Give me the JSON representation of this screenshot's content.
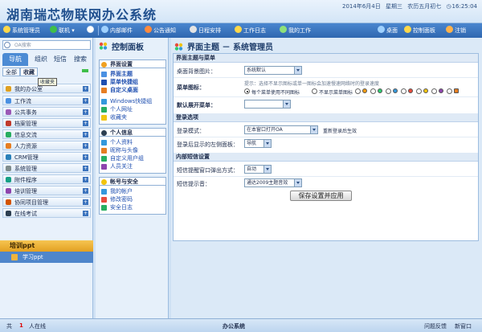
{
  "header": {
    "title": "湖南瑞芯物联网办公系统",
    "date": "2014年6月4日",
    "weekday": "星期三",
    "lunar": "农历五月初七",
    "time": "16:25:04"
  },
  "toolbar": {
    "user": "系统管理员",
    "status": "联机",
    "items": [
      "内部邮件",
      "公告通知",
      "日程安排",
      "工作日志",
      "我的工作"
    ],
    "right": [
      "桌面",
      "控制面板",
      "注销"
    ]
  },
  "sidebar": {
    "search_placeholder": "OA搜索",
    "tabs": [
      "导航",
      "组织",
      "短信",
      "搜索"
    ],
    "subtabs": [
      "全部",
      "收藏"
    ],
    "tooltip": "收藏夹",
    "items": [
      "我的办公室",
      "工作流",
      "公共事务",
      "档案管理",
      "信息交流",
      "人力资源",
      "CRM管理",
      "系统管理",
      "附件程序",
      "培训管理",
      "协同项目管理",
      "在线考试"
    ],
    "active_item": "培训ppt",
    "active_sub": "学习ppt"
  },
  "control_panel": {
    "title": "控制面板",
    "sections": [
      {
        "label": "界面设置",
        "links": [
          "界面主题",
          "菜单快捷组",
          "自定义桌面"
        ]
      },
      {
        "label": "",
        "links": [
          "Windows快捷组",
          "个人网址",
          "收藏夹"
        ]
      },
      {
        "label": "个人信息",
        "links": [
          "个人资料",
          "昵称与头像",
          "自定义用户组",
          "人员关注"
        ]
      },
      {
        "label": "帐号与安全",
        "links": [
          "我的帐户",
          "修改密码",
          "安全日志"
        ]
      }
    ]
  },
  "main": {
    "title": "界面主题 － 系统管理员",
    "sec_theme": "界面主题与菜单",
    "bg_label": "桌面背景图片：",
    "bg_value": "系统默认",
    "menu_icon_label": "菜单图标：",
    "menu_icon_hint": "提示：选择不显示图标或单一图标会加速慢速网络时的登录速度",
    "radio_each": "每个菜单使用不同图标",
    "radio_none": "不显示菜单图标",
    "expand_label": "默认展开菜单：",
    "expand_value": "",
    "sec_login": "登录选项",
    "login_mode_label": "登录模式：",
    "login_mode_value": "在本窗口打开OA",
    "login_mode_hint": "重新登录后生效",
    "left_panel_label": "登录后显示的左侧面板：",
    "left_panel_value": "导航",
    "sec_sms": "内部短信设置",
    "popup_label": "短信提醒窗口弹出方式：",
    "popup_value": "自动",
    "sound_label": "短信提示音：",
    "sound_value": "通达2009主题音效",
    "save_label": "保存设置并应用"
  },
  "status": {
    "total_prefix": "共",
    "online_count": "1",
    "online_suffix": "人在线",
    "center": "办公系统",
    "feedback": "问题反馈",
    "new_window": "新窗口"
  },
  "colors": {
    "accent": "#2f67b0",
    "highlight": "#e3a021"
  }
}
